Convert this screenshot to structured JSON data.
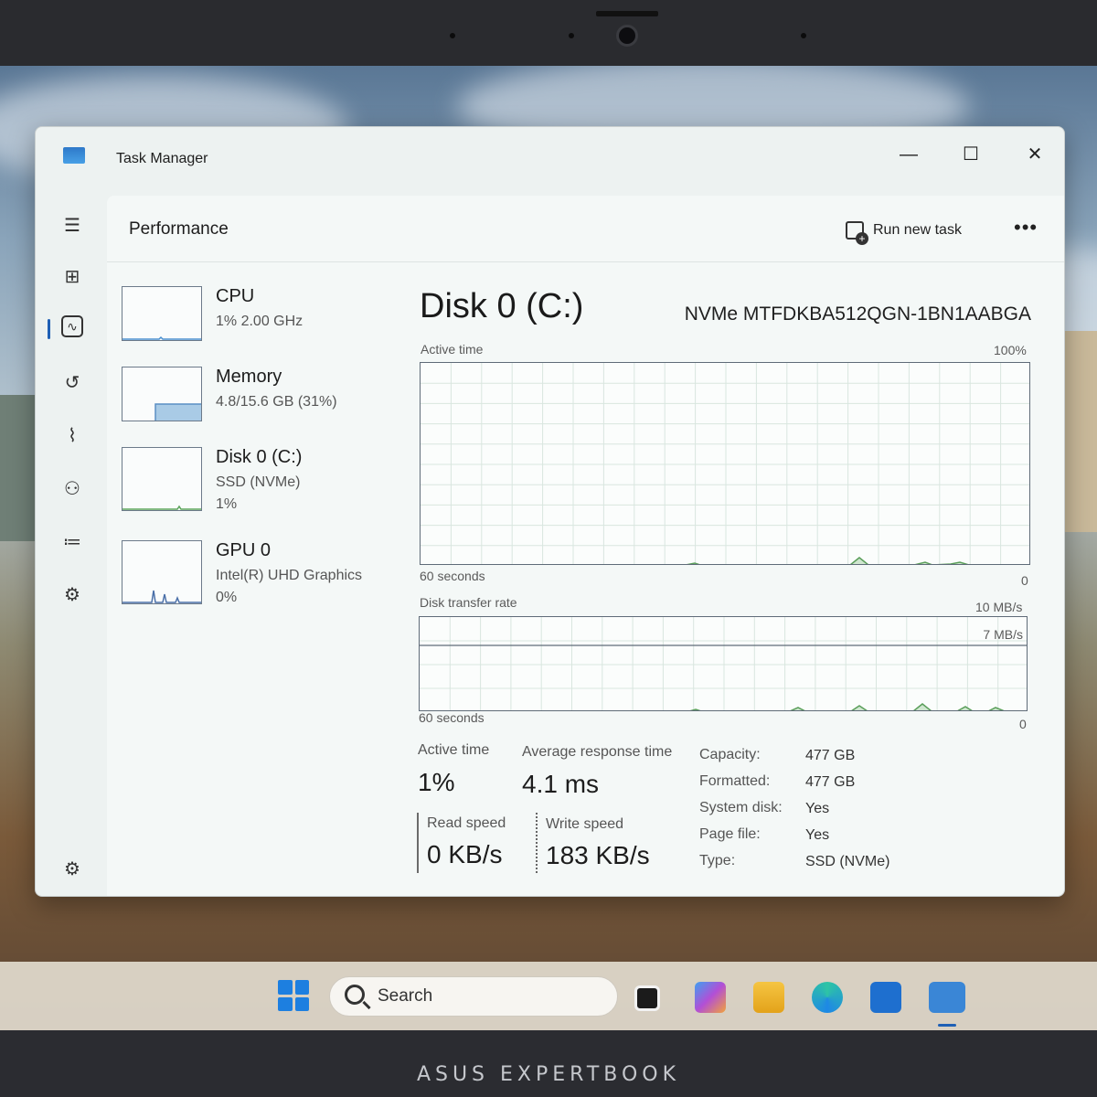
{
  "device_brand": "ASUS EXPERTBOOK",
  "window": {
    "title": "Task Manager",
    "controls": {
      "minimize": "—",
      "maximize": "☐",
      "close": "✕"
    }
  },
  "nav_icons": [
    "hamburger-menu-icon",
    "processes-icon",
    "performance-icon",
    "app-history-icon",
    "startup-apps-icon",
    "users-icon",
    "details-icon",
    "services-icon",
    "settings-icon"
  ],
  "header": {
    "title": "Performance",
    "run_new_task": "Run new task",
    "more": "•••"
  },
  "devices": [
    {
      "name": "CPU",
      "line1": "1% 2.00 GHz",
      "line2": ""
    },
    {
      "name": "Memory",
      "line1": "4.8/15.6 GB (31%)",
      "line2": ""
    },
    {
      "name": "Disk 0 (C:)",
      "line1": "SSD (NVMe)",
      "line2": "1%"
    },
    {
      "name": "GPU 0",
      "line1": "Intel(R) UHD Graphics",
      "line2": "0%"
    }
  ],
  "detail": {
    "title": "Disk 0 (C:)",
    "model": "NVMe MTFDKBA512QGN-1BN1AABGA",
    "active_graph": {
      "label": "Active time",
      "max": "100%",
      "time_span": "60 seconds",
      "min": "0"
    },
    "transfer_graph": {
      "label": "Disk transfer rate",
      "max": "10 MB/s",
      "line_label": "7 MB/s",
      "time_span": "60 seconds",
      "min": "0"
    },
    "stats": {
      "active_time_label": "Active time",
      "active_time_value": "1%",
      "avg_response_label": "Average response time",
      "avg_response_value": "4.1 ms",
      "read_label": "Read speed",
      "read_value": "0 KB/s",
      "write_label": "Write speed",
      "write_value": "183 KB/s"
    },
    "properties": [
      {
        "key": "Capacity:",
        "value": "477 GB"
      },
      {
        "key": "Formatted:",
        "value": "477 GB"
      },
      {
        "key": "System disk:",
        "value": "Yes"
      },
      {
        "key": "Page file:",
        "value": "Yes"
      },
      {
        "key": "Type:",
        "value": "SSD (NVMe)"
      }
    ]
  },
  "taskbar": {
    "search_label": "Search",
    "apps": [
      "task-view-icon",
      "microsoft-365-icon",
      "file-explorer-icon",
      "edge-icon",
      "microsoft-store-icon",
      "task-manager-icon"
    ]
  },
  "colors": {
    "accent": "#1e5fb5",
    "graph_border": "#5f6b78",
    "memory_fill": "#a9cbe6"
  }
}
